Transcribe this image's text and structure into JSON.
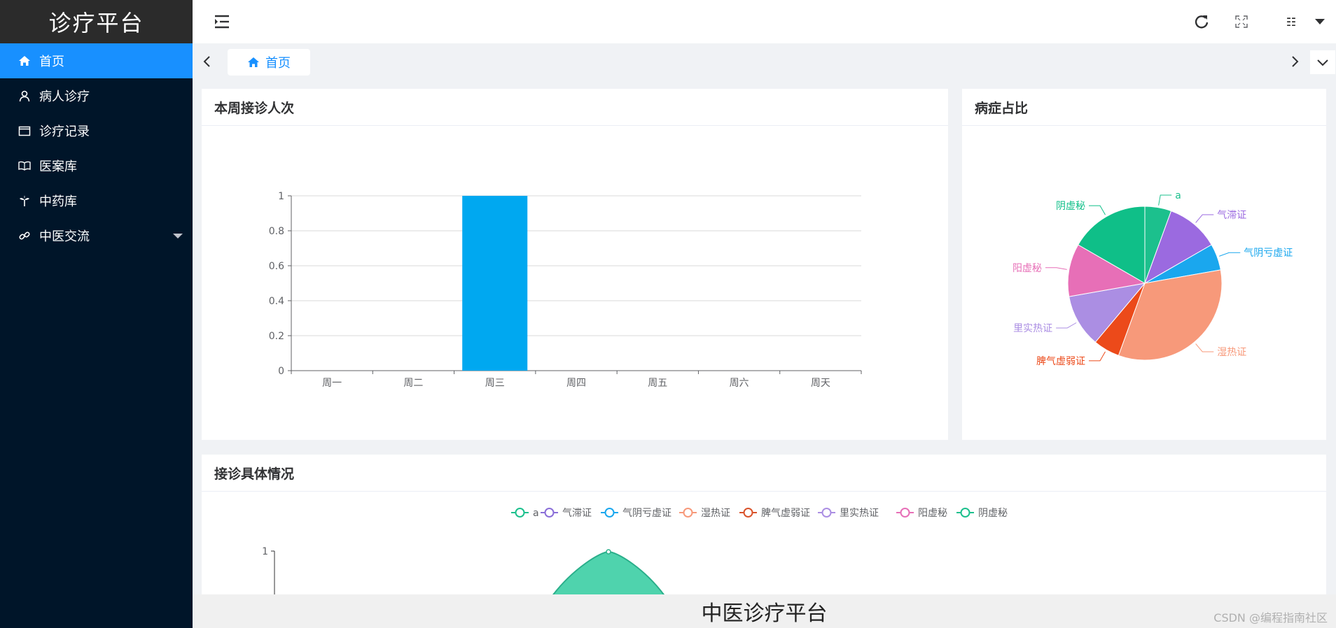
{
  "app": {
    "title": "诊疗平台"
  },
  "sidebar": {
    "items": [
      {
        "label": "首页",
        "icon": "home-icon",
        "active": true
      },
      {
        "label": "病人诊疗",
        "icon": "user-icon",
        "active": false
      },
      {
        "label": "诊疗记录",
        "icon": "folder-icon",
        "active": false
      },
      {
        "label": "医案库",
        "icon": "book-icon",
        "active": false
      },
      {
        "label": "中药库",
        "icon": "plant-icon",
        "active": false
      },
      {
        "label": "中医交流",
        "icon": "link-icon",
        "active": false,
        "has_submenu": true
      }
    ]
  },
  "header": {
    "menu_toggle_icon": "menu-fold-icon",
    "refresh_icon": "refresh-icon",
    "fullscreen_icon": "fullscreen-icon",
    "avatar_icon": "avatar-icon",
    "dropdown_icon": "caret-down-icon"
  },
  "tabs": {
    "items": [
      {
        "label": "首页",
        "icon": "home-icon"
      }
    ]
  },
  "cards": {
    "weekly": {
      "title": "本周接诊人次"
    },
    "disease": {
      "title": "病症占比"
    },
    "detail": {
      "title": "接诊具体情况"
    }
  },
  "footer": {
    "title": "中医诊疗平台",
    "watermark": "CSDN @编程指南社区"
  },
  "colors": {
    "sidebar_bg": "#001529",
    "active_menu": "#1890ff",
    "bar": "#00a8f0"
  },
  "chart_data": [
    {
      "type": "bar",
      "categories": [
        "周一",
        "周二",
        "周三",
        "周四",
        "周五",
        "周六",
        "周天"
      ],
      "values": [
        0,
        0,
        1,
        0,
        0,
        0,
        0
      ],
      "ylim": [
        0,
        1
      ],
      "yticks": [
        0,
        0.2,
        0.4,
        0.6,
        0.8,
        1
      ],
      "grid": true
    },
    {
      "type": "pie",
      "slices": [
        {
          "name": "a",
          "value": 1,
          "color": "#1cc08d"
        },
        {
          "name": "气滞证",
          "value": 2,
          "color": "#9b6ae0"
        },
        {
          "name": "气阴亏虚证",
          "value": 1,
          "color": "#1aa7ee"
        },
        {
          "name": "湿热证",
          "value": 6,
          "color": "#f7997a"
        },
        {
          "name": "脾气虚弱证",
          "value": 1,
          "color": "#ec4a1a"
        },
        {
          "name": "里实热证",
          "value": 2,
          "color": "#ab8ee3"
        },
        {
          "name": "阳虚秘",
          "value": 2,
          "color": "#e76fb7"
        },
        {
          "name": "阴虚秘",
          "value": 3,
          "color": "#0fbf88"
        }
      ]
    },
    {
      "type": "line",
      "legend": [
        "a",
        "气滞证",
        "气阴亏虚证",
        "湿热证",
        "脾气虚弱证",
        "里实热证",
        "阳虚秘",
        "阴虚秘"
      ],
      "legend_colors": [
        "#1cc08d",
        "#8a6ed8",
        "#1aa7ee",
        "#f7997a",
        "#d9532b",
        "#ab8ee3",
        "#e76fb7",
        "#1cc08d"
      ],
      "legend_position": "top-center",
      "ylim": [
        0,
        1
      ],
      "yticks_visible": [
        1
      ],
      "area_color": "#4fd3ad"
    }
  ]
}
